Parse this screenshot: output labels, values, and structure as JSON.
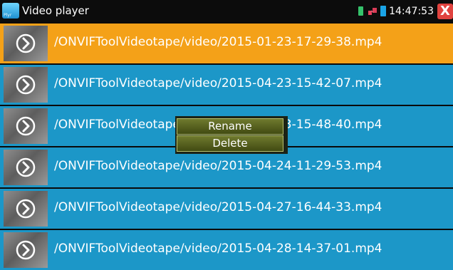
{
  "statusbar": {
    "app_title": "Video player",
    "app_icon_text": "Plyr",
    "clock": "14:47:53",
    "close_glyph": "X",
    "icons": [
      "battery-icon",
      "network-icon",
      "battery2-icon",
      "close-icon"
    ]
  },
  "files": [
    {
      "path": "/ONVIFToolVideotape/video/2015-01-23-17-29-38.mp4",
      "selected": true
    },
    {
      "path": "/ONVIFToolVideotape/video/2015-04-23-15-42-07.mp4",
      "selected": false
    },
    {
      "path": "/ONVIFToolVideotape/video/2015-04-23-15-48-40.mp4",
      "selected": false
    },
    {
      "path": "/ONVIFToolVideotape/video/2015-04-24-11-29-53.mp4",
      "selected": false
    },
    {
      "path": "/ONVIFToolVideotape/video/2015-04-27-16-44-33.mp4",
      "selected": false
    },
    {
      "path": "/ONVIFToolVideotape/video/2015-04-28-14-37-01.mp4",
      "selected": false
    }
  ],
  "context_menu": {
    "rename_label": "Rename",
    "delete_label": "Delete"
  },
  "colors": {
    "row": "#1c97c8",
    "selected_row": "#f4a118",
    "menu_button": "#5b6520"
  }
}
